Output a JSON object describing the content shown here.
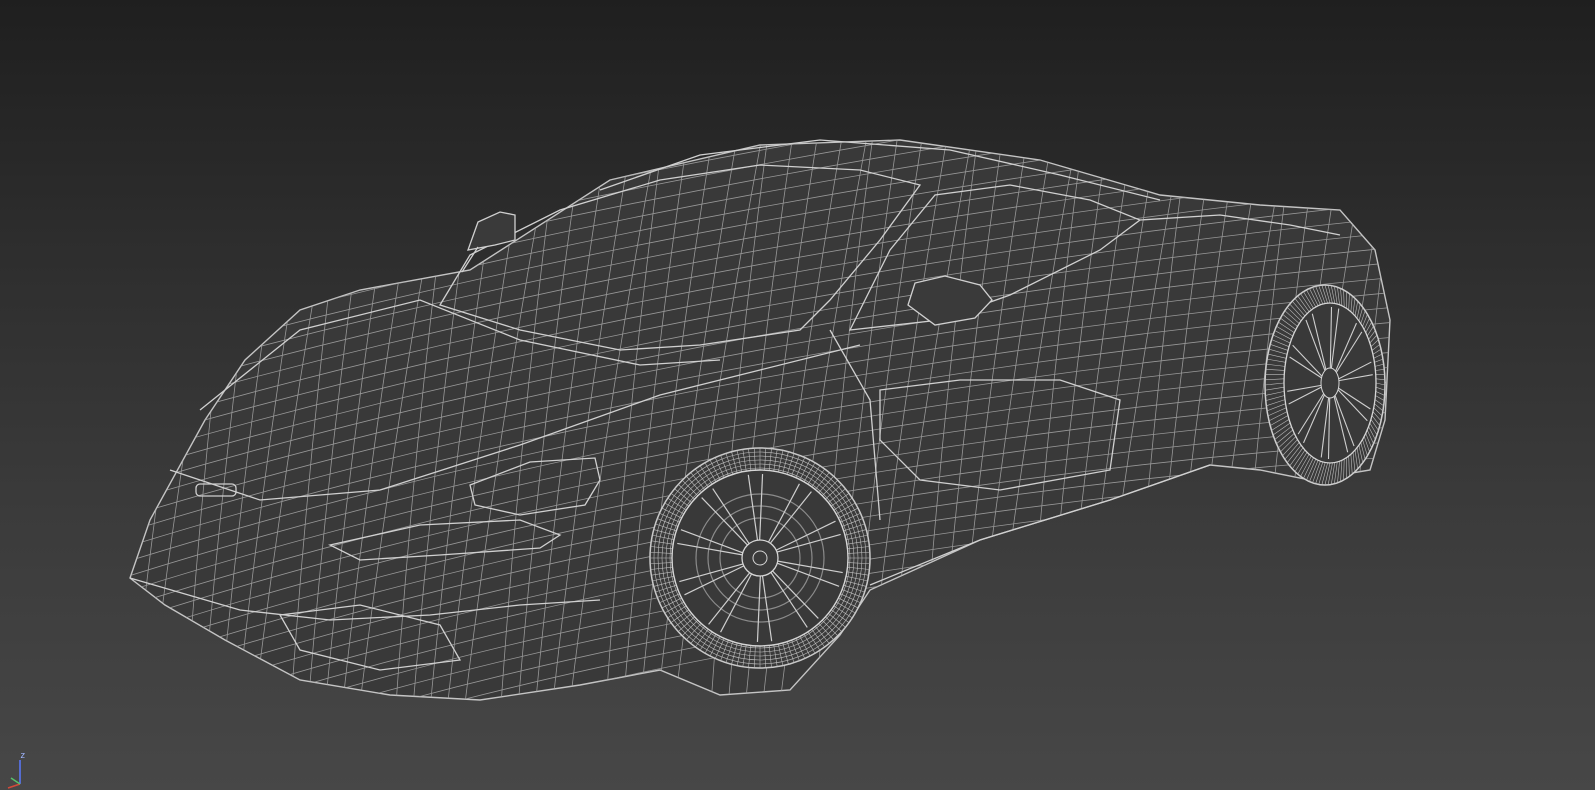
{
  "viewport": {
    "background_top": "#1f1f1f",
    "background_bottom": "#474747",
    "wire_color": "#b8b8b8",
    "body_fill": "#3a3a3a"
  },
  "scene": {
    "object": "car-wireframe-mesh",
    "mesh_ambient_color": "#3a3a3a"
  },
  "axis_gizmo": {
    "z_label": "z",
    "x_color": "#d24a3b",
    "y_color": "#56c26a",
    "z_color": "#5a78ff"
  }
}
